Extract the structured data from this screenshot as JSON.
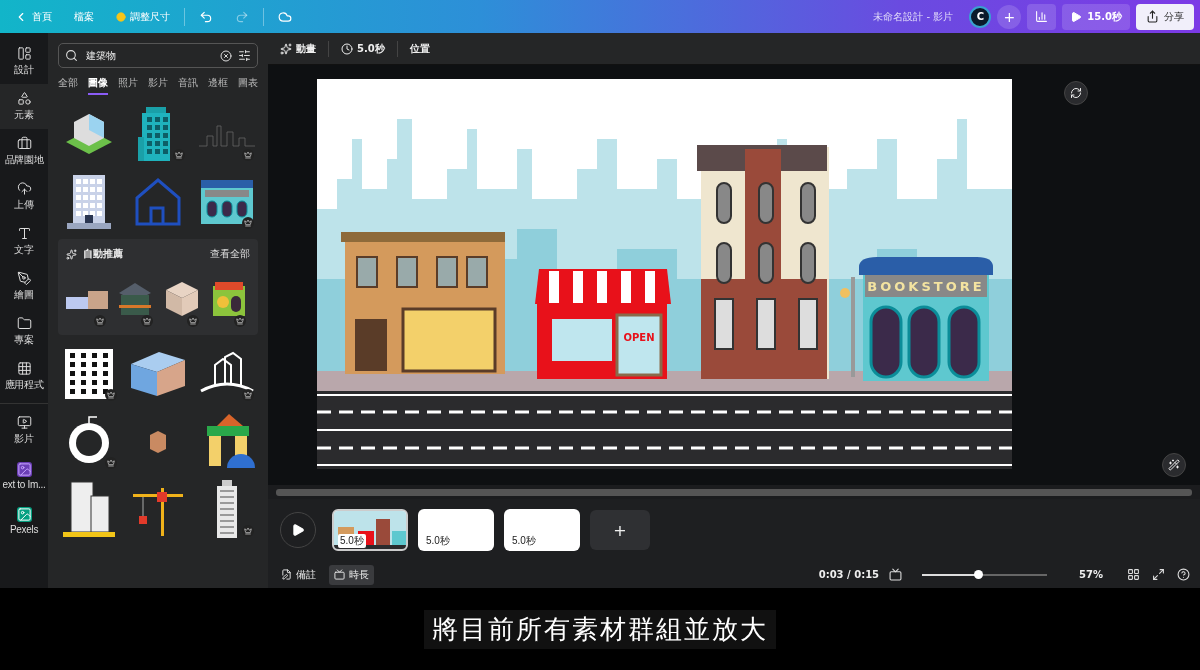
{
  "topbar": {
    "home": "首頁",
    "file": "檔案",
    "resize": "調整尺寸",
    "undo_disabled": false,
    "redo_disabled": true,
    "title": "未命名設計 - 影片",
    "avatar": "C",
    "add": "+",
    "play": "15.0秒",
    "share": "分享"
  },
  "rail": [
    {
      "label": "設計",
      "selected": false
    },
    {
      "label": "元素",
      "selected": true
    },
    {
      "label": "品牌園地",
      "selected": false
    },
    {
      "label": "上傳",
      "selected": false
    },
    {
      "label": "文字",
      "selected": false
    },
    {
      "label": "繪圖",
      "selected": false
    },
    {
      "label": "專案",
      "selected": false
    },
    {
      "label": "應用程式",
      "selected": false
    },
    {
      "label": "影片",
      "selected": false
    },
    {
      "label": "ext to Im...",
      "selected": false
    },
    {
      "label": "Pexels",
      "selected": false
    }
  ],
  "search": {
    "value": "建築物"
  },
  "filter_tabs": [
    {
      "label": "全部",
      "selected": false
    },
    {
      "label": "圖像",
      "selected": true
    },
    {
      "label": "照片",
      "selected": false
    },
    {
      "label": "影片",
      "selected": false
    },
    {
      "label": "音訊",
      "selected": false
    },
    {
      "label": "邊框",
      "selected": false
    },
    {
      "label": "圖表",
      "selected": false
    }
  ],
  "results_top": [
    {
      "kind": "iso",
      "premium": false
    },
    {
      "kind": "tower",
      "premium": true
    },
    {
      "kind": "skyline",
      "premium": true
    },
    {
      "kind": "office",
      "premium": false
    },
    {
      "kind": "house",
      "premium": false
    },
    {
      "kind": "shop",
      "premium": true
    }
  ],
  "recommend": {
    "title": "自動推薦",
    "see_all": "查看全部",
    "items": [
      {
        "kind": "flat",
        "premium": true
      },
      {
        "kind": "cabin",
        "premium": true
      },
      {
        "kind": "cube",
        "premium": true
      },
      {
        "kind": "toyshop",
        "premium": true
      }
    ]
  },
  "results_bottom": [
    {
      "kind": "blocks",
      "premium": true
    },
    {
      "kind": "bluehouse",
      "premium": false
    },
    {
      "kind": "city",
      "premium": true
    },
    {
      "kind": "globe",
      "premium": true
    },
    {
      "kind": "small",
      "premium": false
    },
    {
      "kind": "toy",
      "premium": false
    },
    {
      "kind": "twin",
      "premium": false
    },
    {
      "kind": "crane",
      "premium": false
    },
    {
      "kind": "slim",
      "premium": true
    }
  ],
  "toolbar": {
    "animate": "動畫",
    "duration": "5.0秒",
    "position": "位置"
  },
  "canvas": {
    "sign": "BOOKSTORE",
    "door_sign": "OPEN"
  },
  "timeline": {
    "clips": [
      {
        "duration": "5.0秒",
        "kind": "scene",
        "selected": true
      },
      {
        "duration": "5.0秒",
        "kind": "blank",
        "selected": false
      },
      {
        "duration": "5.0秒",
        "kind": "blank",
        "selected": false
      }
    ],
    "add": "+"
  },
  "statusbar": {
    "notes": "備註",
    "duration": "時長",
    "duration_selected": true,
    "time": "0:03 / 0:15",
    "zoom": {
      "level": 0.45
    },
    "zoom_reading": "57%"
  },
  "subtitle": "將目前所有素材群組並放大"
}
